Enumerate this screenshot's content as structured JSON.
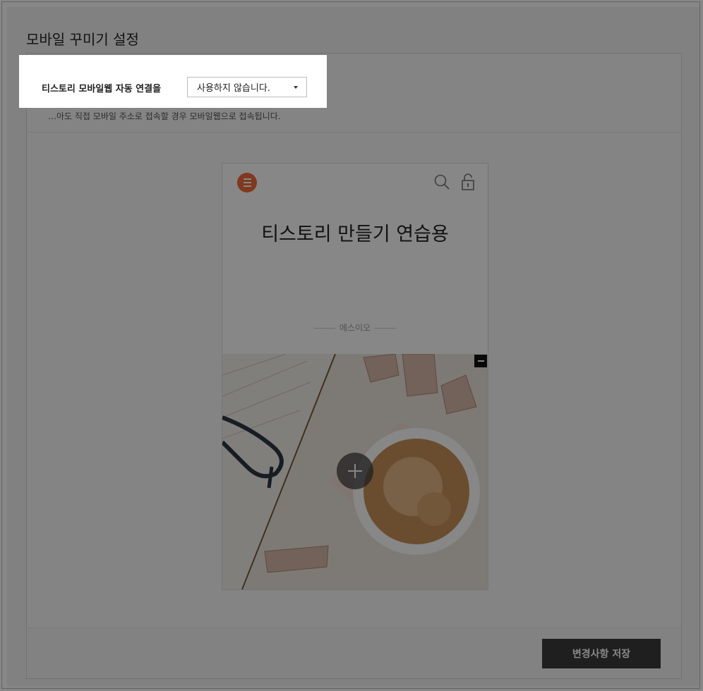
{
  "page": {
    "title": "모바일 꾸미기 설정",
    "description": "…아도 직접 모바일 주소로 접속할 경우 모바일웹으로 접속됩니다."
  },
  "auto_connect": {
    "label": "티스토리 모바일웹 자동 연결을",
    "selected": "사용하지 않습니다."
  },
  "preview": {
    "blog_title": "티스토리 만들기 연습용",
    "author": "에스이오",
    "icons": [
      "menu-icon",
      "search-icon",
      "lock-icon",
      "remove-icon",
      "add-icon"
    ],
    "accent_color": "#f26b3a"
  },
  "footer": {
    "save_label": "변경사항 저장"
  }
}
